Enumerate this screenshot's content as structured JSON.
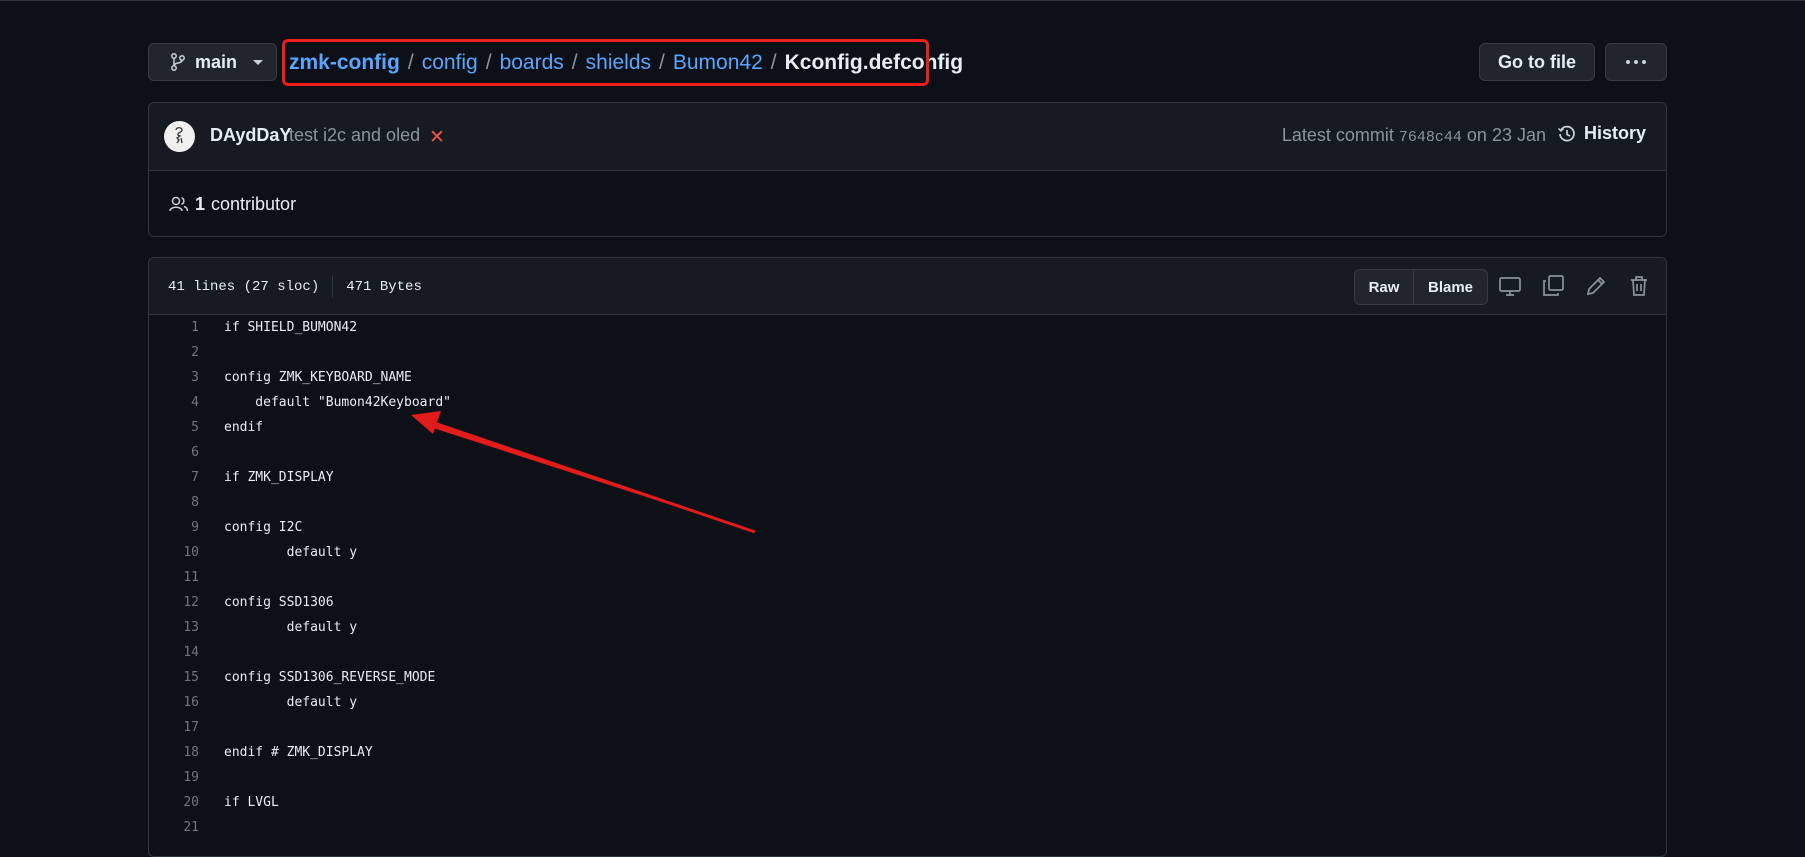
{
  "toolbar": {
    "branch": "main",
    "breadcrumb": {
      "repo": "zmk-config",
      "dirs": [
        "config",
        "boards",
        "shields",
        "Bumon42"
      ],
      "file": "Kconfig.defconfig",
      "separator": "/"
    },
    "go_to_file": "Go to file"
  },
  "commit": {
    "author": "DAydDaY",
    "message": "test i2c and oled",
    "status": "✕",
    "meta_prefix": "Latest commit",
    "sha": "7648c44",
    "meta_suffix": "on 23 Jan",
    "history_label": "History",
    "contributors_count": "1",
    "contributors_label": "contributor"
  },
  "file": {
    "lines_info": "41 lines (27 sloc)",
    "size": "471 Bytes",
    "raw_label": "Raw",
    "blame_label": "Blame",
    "code": [
      {
        "n": "1",
        "text": "if SHIELD_BUMON42"
      },
      {
        "n": "2",
        "text": ""
      },
      {
        "n": "3",
        "text": "config ZMK_KEYBOARD_NAME"
      },
      {
        "n": "4",
        "text": "    default \"Bumon42Keyboard\""
      },
      {
        "n": "5",
        "text": "endif"
      },
      {
        "n": "6",
        "text": ""
      },
      {
        "n": "7",
        "text": "if ZMK_DISPLAY"
      },
      {
        "n": "8",
        "text": ""
      },
      {
        "n": "9",
        "text": "config I2C"
      },
      {
        "n": "10",
        "text": "        default y"
      },
      {
        "n": "11",
        "text": ""
      },
      {
        "n": "12",
        "text": "config SSD1306"
      },
      {
        "n": "13",
        "text": "        default y"
      },
      {
        "n": "14",
        "text": ""
      },
      {
        "n": "15",
        "text": "config SSD1306_REVERSE_MODE"
      },
      {
        "n": "16",
        "text": "        default y"
      },
      {
        "n": "17",
        "text": ""
      },
      {
        "n": "18",
        "text": "endif # ZMK_DISPLAY"
      },
      {
        "n": "19",
        "text": ""
      },
      {
        "n": "20",
        "text": "if LVGL"
      },
      {
        "n": "21",
        "text": ""
      }
    ]
  },
  "colors": {
    "background": "#0d1117",
    "link": "#58a6ff",
    "annotation_red": "#ef1d1d"
  },
  "icons": [
    "git-branch-icon",
    "kebab-icon",
    "avatar",
    "x-icon",
    "history-icon",
    "people-icon",
    "desktop-icon",
    "copy-icon",
    "pencil-icon",
    "trash-icon"
  ]
}
